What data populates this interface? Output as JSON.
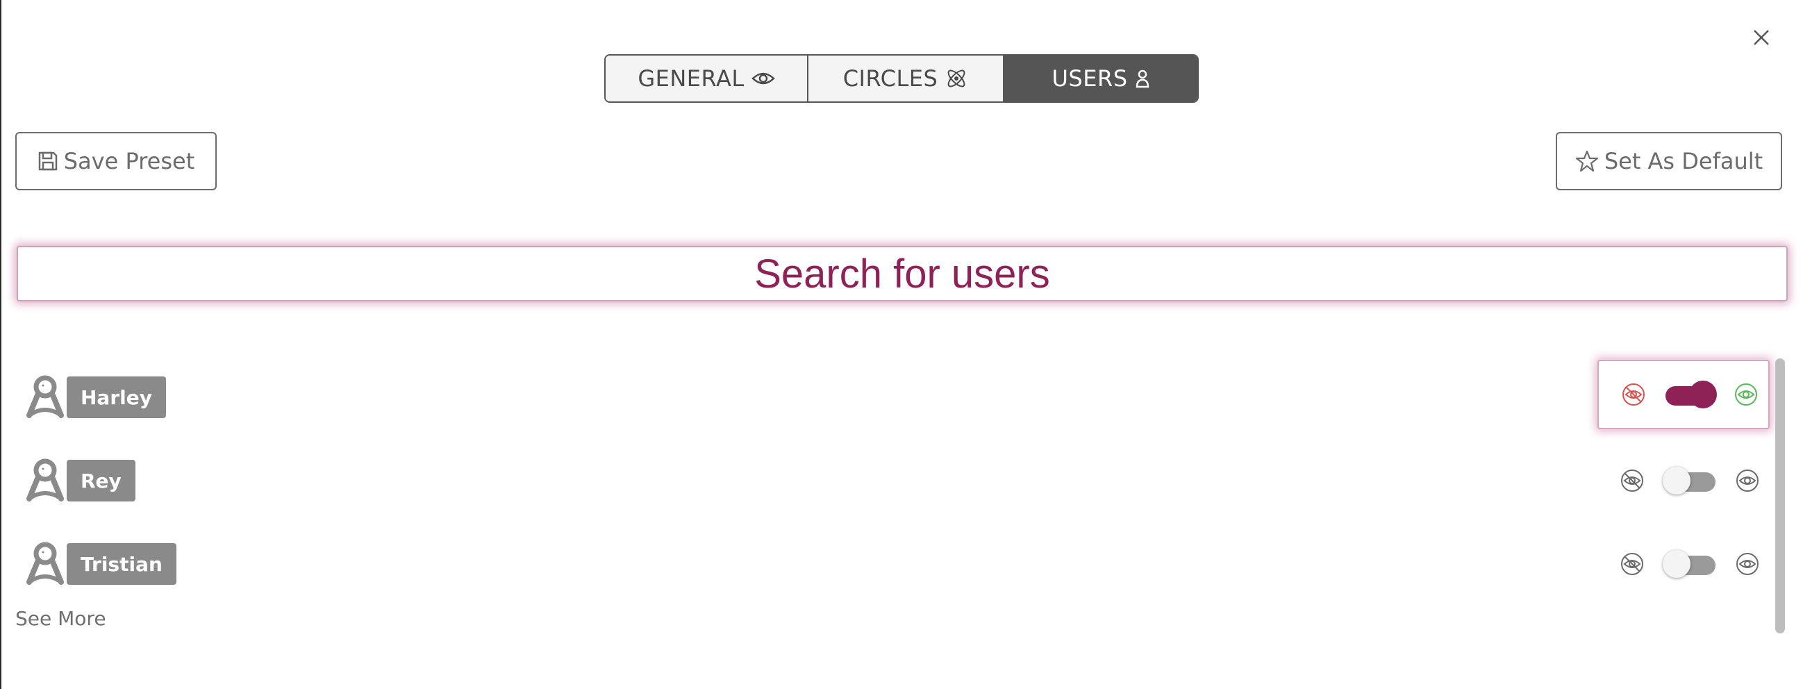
{
  "tabs": [
    {
      "label": "GENERAL",
      "icon": "eye-icon",
      "active": false
    },
    {
      "label": "CIRCLES",
      "icon": "atom-icon",
      "active": false
    },
    {
      "label": "USERS",
      "icon": "user-icon",
      "active": true
    }
  ],
  "toolbar": {
    "save_label": "Save Preset",
    "default_label": "Set As Default"
  },
  "search": {
    "placeholder": "Search for users",
    "value": ""
  },
  "users": [
    {
      "name": "Harley",
      "visible": true
    },
    {
      "name": "Rey",
      "visible": false
    },
    {
      "name": "Tristian",
      "visible": false
    }
  ],
  "see_more_label": "See More",
  "colors": {
    "accent": "#8e2257",
    "tab_active_bg": "#555555",
    "hidden_icon_active": "#d9534f",
    "visible_icon_active": "#5cb85c",
    "icon_inactive": "#6b6b6b"
  }
}
